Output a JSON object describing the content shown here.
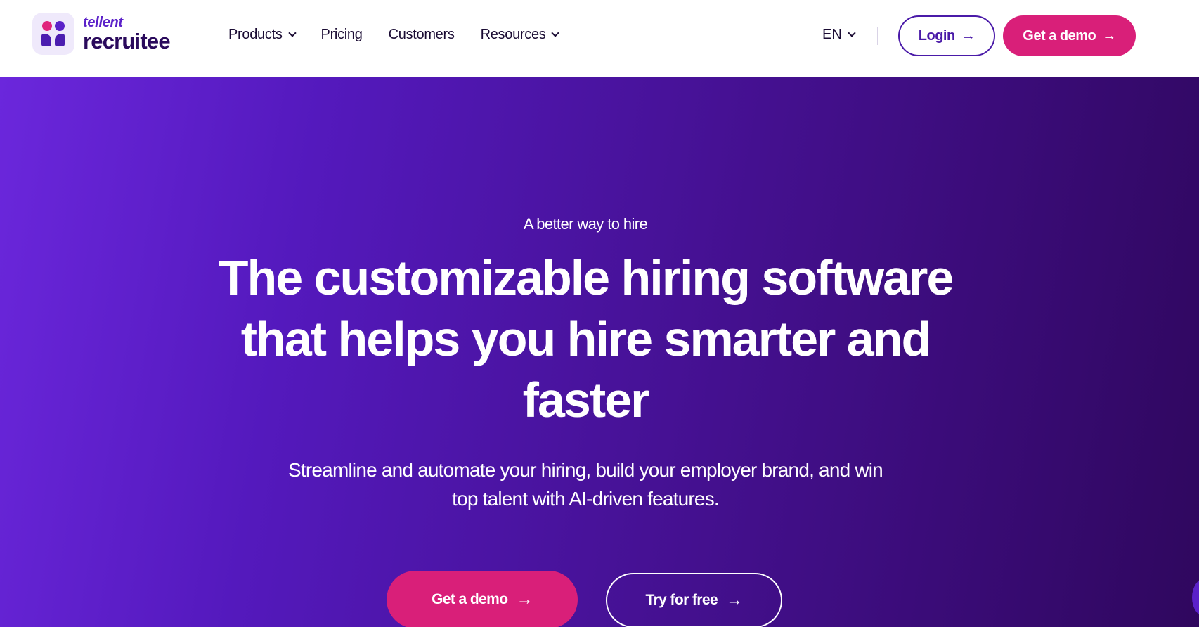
{
  "header": {
    "logo": {
      "small": "tellent",
      "big": "recruitee"
    },
    "nav": [
      {
        "label": "Products",
        "dropdown": true
      },
      {
        "label": "Pricing",
        "dropdown": false
      },
      {
        "label": "Customers",
        "dropdown": false
      },
      {
        "label": "Resources",
        "dropdown": true
      }
    ],
    "language": "EN",
    "login_label": "Login",
    "demo_label": "Get a demo"
  },
  "hero": {
    "eyebrow": "A better way to hire",
    "headline_lines": [
      "The customizable hiring software",
      "that helps you hire smarter and",
      "faster"
    ],
    "subtitle_lines": [
      "Streamline and automate your hiring, build your employer brand, and win",
      "top talent with AI-driven features."
    ],
    "cta_primary": "Get a demo",
    "cta_secondary": "Try for free"
  },
  "colors": {
    "brand_purple": "#5b21c9",
    "brand_pink": "#d91f79",
    "hero_gradient_start": "#6b27dc",
    "hero_gradient_end": "#2f075e"
  },
  "icons": {
    "arrow": "→",
    "chevron": "chevron-down-icon"
  }
}
